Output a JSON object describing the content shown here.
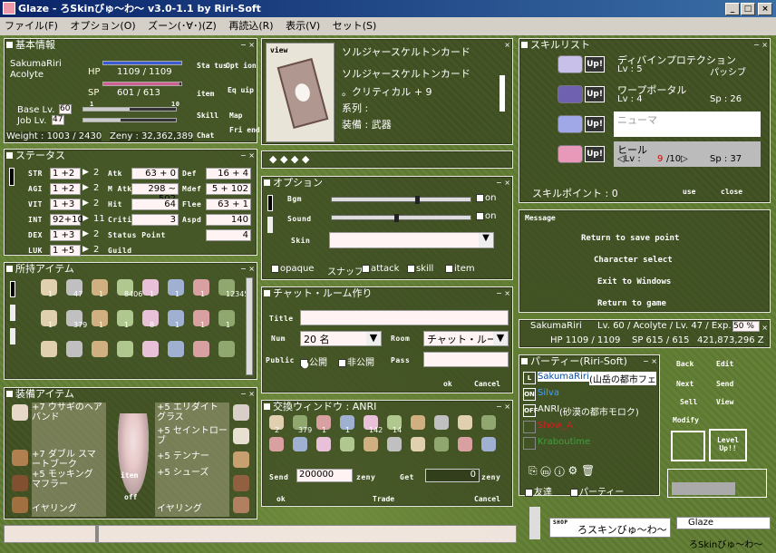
{
  "window": {
    "title": "Glaze - ろSkinびゅ〜わ〜 v3.0-1.1 by Riri-Soft",
    "min": "_",
    "max": "□",
    "close": "×"
  },
  "menu": [
    "ファイル(F)",
    "オプション(O)",
    "ズーン(･∀･)(Z)",
    "再読込(R)",
    "表示(V)",
    "セット(S)"
  ],
  "basic": {
    "title": "基本情報",
    "name": "SakumaRiri",
    "job": "Acolyte",
    "hp_label": "HP",
    "hp": "1109 / 1109",
    "sp_label": "SP",
    "sp": "601 / 613",
    "hp_frac": 1.0,
    "sp_frac": 0.98,
    "base_label": "Base Lv.",
    "base": "60",
    "job_label": "Job Lv.",
    "joblv": "47",
    "tick1": "1",
    "tick10": "10",
    "weight": "Weight : 1003 / 2430",
    "zeny": "Zeny : 32,362,389",
    "buttons": [
      "Sta tus",
      "Opt ion",
      "item",
      "Eq uip",
      "Skill",
      "Map",
      "Chat",
      "Fri end"
    ]
  },
  "status": {
    "title": "ステータス",
    "rows": [
      {
        "k": "STR",
        "v": "1 +2",
        "p": "2",
        "a": "Atk",
        "av": "63 + 0",
        "b": "Def",
        "bv": "16 + 4"
      },
      {
        "k": "AGI",
        "v": "1 +2",
        "p": "2",
        "a": "M Atk",
        "av": "298 ~ 502",
        "b": "Mdef",
        "bv": "5 + 102"
      },
      {
        "k": "VIT",
        "v": "1 +3",
        "p": "2",
        "a": "Hit",
        "av": "64",
        "b": "Flee",
        "bv": "63 + 1"
      },
      {
        "k": "INT",
        "v": "92+10",
        "p": "11",
        "a": "Critical",
        "av": "3",
        "b": "Aspd",
        "bv": "140"
      },
      {
        "k": "DEX",
        "v": "1 +3",
        "p": "2",
        "a": "Status Point",
        "av": "",
        "b": "",
        "bv": "4"
      },
      {
        "k": "LUK",
        "v": "1 +5",
        "p": "2",
        "a": "Guild",
        "av": "",
        "b": "",
        "bv": ""
      }
    ]
  },
  "items": {
    "title": "所持アイテム",
    "counts": [
      "1",
      "47",
      "1",
      "8406",
      "1",
      "1",
      "1",
      "12345",
      "1",
      "379",
      "1",
      "1",
      "8",
      "1",
      "1",
      "1"
    ]
  },
  "equip": {
    "title": "装備アイテム",
    "left": [
      "+7 ウサギのヘアバンド",
      "+7 ダブル スマートブーク",
      "+5 モッキング マフラー",
      "イヤリング"
    ],
    "right": [
      "+5 エリダイト グラス",
      "+5 セイントローブ",
      "+5 テンナー",
      "+5 シューズ",
      "イヤリング"
    ],
    "item_btn": "item",
    "off_btn": "off"
  },
  "card": {
    "title": "view",
    "name": "ソルジャースケルトンカード",
    "name2": "ソルジャースケルトンカード",
    "desc": "。クリティカル + 9",
    "kind": "系列 :",
    "equip": "装備 : 武器"
  },
  "option": {
    "title": "オプション",
    "bgm": "Bgm",
    "sound": "Sound",
    "skin": "Skin",
    "on1": "on",
    "on2": "on",
    "opaque": "opaque",
    "snap": "スナップ",
    "attack": "attack",
    "skill": "skill",
    "item": "item",
    "bgm_frac": 0.6,
    "sound_frac": 0.45
  },
  "chat": {
    "title": "チャット・ルーム作り",
    "title_label": "Title",
    "num_label": "Num",
    "num": "20 名",
    "room_label": "Room",
    "room": "チャット・ルー",
    "public_label": "Public",
    "open": "公開",
    "closed": "非公開",
    "pass_label": "Pass",
    "ok": "ok",
    "cancel": "Cancel"
  },
  "trade": {
    "title": "交換ウィンドウ : ANRI",
    "counts": [
      "2",
      "379",
      "1",
      "1",
      "142",
      "14"
    ],
    "send_label": "Send",
    "send": "200000",
    "zeny1": "zeny",
    "get_label": "Get",
    "get": "0",
    "zeny2": "zeny",
    "ok": "ok",
    "trade": "Trade",
    "cancel": "Cancel"
  },
  "skills": {
    "title": "スキルリスト",
    "up": "Up!",
    "list": [
      {
        "name": "ディバインプロテクション",
        "lv": "Lv : 5",
        "extra": "パッシブ",
        "color": "#c8c0e8"
      },
      {
        "name": "ワープポータル",
        "lv": "Lv : 4",
        "extra": "Sp : 26",
        "color": "#7060b0"
      },
      {
        "name": "ニューマ",
        "lv": "",
        "extra": "",
        "color": "#a0a8e8"
      },
      {
        "name": "ヒール",
        "lv": "◁Lv : ",
        "lvval": "9",
        "lvmax": "/10▷",
        "extra": "Sp : 37",
        "color": "#e898b8"
      }
    ],
    "points": "スキルポイント : 0",
    "use": "use",
    "close": "close"
  },
  "message": {
    "title": "Message",
    "items": [
      "Return to save point",
      "Character select",
      "Exit to Windows",
      "Return to game"
    ]
  },
  "charinfo": {
    "name": "SakumaRiri",
    "info": "Lv. 60 / Acolyte / Lv. 47 / Exp.",
    "exp": "50 %",
    "hp": "HP 1109 / 1109",
    "sp": "SP 615 / 615",
    "zeny": "421,873,296 Z"
  },
  "party": {
    "title": "パーティー(Riri-Soft)",
    "members": [
      {
        "tag": "L",
        "name": "SakumaRiri",
        "loc": "(山岳の都市フェ",
        "color": "#0a4aa0",
        "selected": true
      },
      {
        "tag": "ON",
        "name": "Silva",
        "loc": "",
        "color": "#44a0ff",
        "selected": false
      },
      {
        "tag": "OFF",
        "name": "ANRI",
        "loc": "(砂漠の都市モロク)",
        "color": "#ffffff",
        "selected": false
      },
      {
        "tag": "",
        "name": "Show_A",
        "loc": "",
        "color": "#d02020",
        "selected": false
      },
      {
        "tag": "",
        "name": "Kraboutime",
        "loc": "",
        "color": "#40a040",
        "selected": false
      }
    ],
    "buttons": [
      "Back",
      "Edit",
      "Next",
      "Send",
      "Sell",
      "View",
      "Modify"
    ],
    "levelup": "Level Up!!",
    "friend": "友達",
    "party": "パーティー"
  },
  "bottom": {
    "shop": "SHOP",
    "shop_title": "ろスキンびゅ〜わ〜",
    "glaze": "Glaze",
    "footer": "ろSkinびゅ〜わ〜"
  }
}
